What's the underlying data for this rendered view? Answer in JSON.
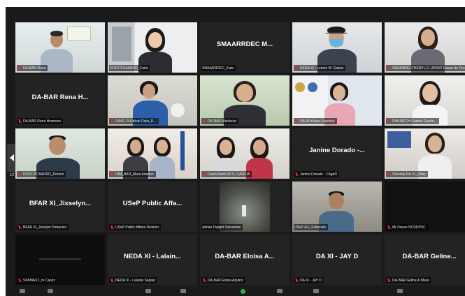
{
  "meeting": {
    "pagination": "1/2",
    "tiles": [
      {
        "id": "r0c0",
        "display": "",
        "name": "DA-BAR-Rosa"
      },
      {
        "id": "r0c1",
        "display": "",
        "name": "DOST-PCAARRD_Carla"
      },
      {
        "id": "r0c2",
        "display": "SMAARRDEC M...",
        "name": "SMAARRDEC_Kate"
      },
      {
        "id": "r0c3",
        "display": "",
        "name": "NEDA XI - Leonie M. Gabas"
      },
      {
        "id": "r0c4",
        "display": "",
        "name": "SMAEMNG CHERYL C...ROSO Davao de Oro"
      },
      {
        "id": "r1c0",
        "display": "DA-BAR Rena H...",
        "name": "DA-BAR Rena Hermoso"
      },
      {
        "id": "r1c1",
        "display": "",
        "name": "DAVE XI-Rohan Dara_R..."
      },
      {
        "id": "r1c2",
        "display": "",
        "name": "DA-BAR Marianne"
      },
      {
        "id": "r1c3",
        "display": "",
        "name": "DA-XI-Krissa Sanchez"
      },
      {
        "id": "r1c4",
        "display": "",
        "name": "PHILMECH Gabriel Guarin..."
      },
      {
        "id": "r2c0",
        "display": "",
        "name": "DOST-PCAARRD_Ronnel"
      },
      {
        "id": "r2c1",
        "display": "",
        "name": "UIM_BAR_Mara Ariadne"
      },
      {
        "id": "r2c2",
        "display": "",
        "name": "Clarin Santi-XII S. GARCIA"
      },
      {
        "id": "r2c3",
        "display": "Janine Dorado -...",
        "name": "Janine Dorado - CAgriO"
      },
      {
        "id": "r2c4",
        "display": "",
        "name": "Shareity DA-XI_Ruby"
      },
      {
        "id": "r3c0",
        "display": "BFAR XI_Jixselyn...",
        "name": "BFAR XI_Jixselyn Portacion"
      },
      {
        "id": "r3c1",
        "display": "USeP Public Affa...",
        "name": "USeP Public Affairs Division"
      },
      {
        "id": "r3c2",
        "display": "",
        "name": "Adrian Dwight Sarventes"
      },
      {
        "id": "r3c3",
        "display": "",
        "name": "USeP ALI_Edderwin"
      },
      {
        "id": "r3c4",
        "display": "",
        "name": "Mr Davao NCRDPSC"
      },
      {
        "id": "r4c0",
        "display": "",
        "name": "SPAMAST_fe Calutz"
      },
      {
        "id": "r4c1",
        "display": "NEDA XI - Lalain...",
        "name": "NEDA XI - Lalaine Sapian"
      },
      {
        "id": "r4c2",
        "display": "DA-BAR Eloisa A...",
        "name": "DA-BAR Eloisa Aquino"
      },
      {
        "id": "r4c3",
        "display": "DA XI - JAY D",
        "name": "DA XI - JAY D"
      },
      {
        "id": "r4c4",
        "display": "DA-BAR Geline...",
        "name": "DA-BAR Geline & Mara"
      }
    ]
  },
  "colors": {
    "background": "#1a1a1a",
    "tile": "#232323",
    "active_speaker": "#d8e85a",
    "muted_mic": "#e0332f"
  }
}
